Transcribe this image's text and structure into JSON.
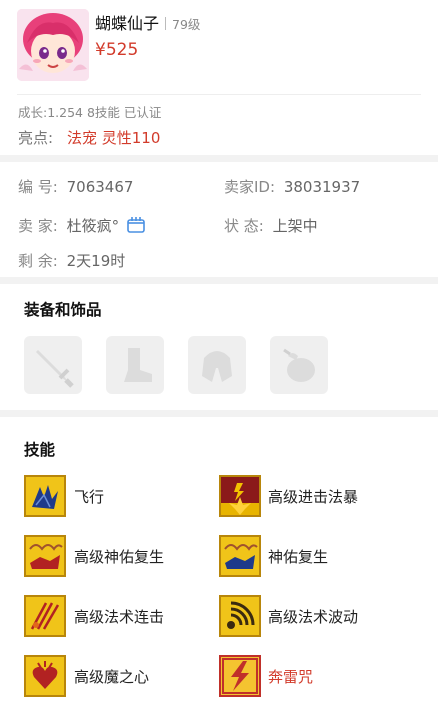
{
  "pet": {
    "name": "蝴蝶仙子",
    "level": "79级",
    "price": "¥525",
    "meta": "成长:1.254 8技能 已认证",
    "highlight_label": "亮点:",
    "highlight_value": "法宠  灵性110"
  },
  "info": {
    "id_label": "编   号:",
    "id_value": "7063467",
    "seller_id_label": "卖家ID:",
    "seller_id_value": "38031937",
    "seller_label": "卖   家:",
    "seller_value": "杜筱疯°",
    "status_label": "状   态:",
    "status_value": "上架中",
    "remain_label": "剩   余:",
    "remain_value": "2天19时"
  },
  "equipment": {
    "title": "装备和饰品",
    "slots": [
      "sword-icon",
      "boot-icon",
      "armor-icon",
      "pouch-icon"
    ]
  },
  "skills": {
    "title": "技能",
    "items": [
      {
        "label": "飞行",
        "icon": "wing-icon"
      },
      {
        "label": "高级进击法暴",
        "icon": "magic-burst-icon"
      },
      {
        "label": "高级神佑复生",
        "icon": "revive-icon"
      },
      {
        "label": "神佑复生",
        "icon": "revive-icon"
      },
      {
        "label": "高级法术连击",
        "icon": "combo-icon"
      },
      {
        "label": "高级法术波动",
        "icon": "wave-icon"
      },
      {
        "label": "高级魔之心",
        "icon": "heart-icon"
      },
      {
        "label": "奔雷咒",
        "icon": "thunder-icon"
      }
    ]
  },
  "colors": {
    "price": "#d23b2b",
    "skill_border": "#b8860b",
    "thunder_border": "#c0302a"
  }
}
